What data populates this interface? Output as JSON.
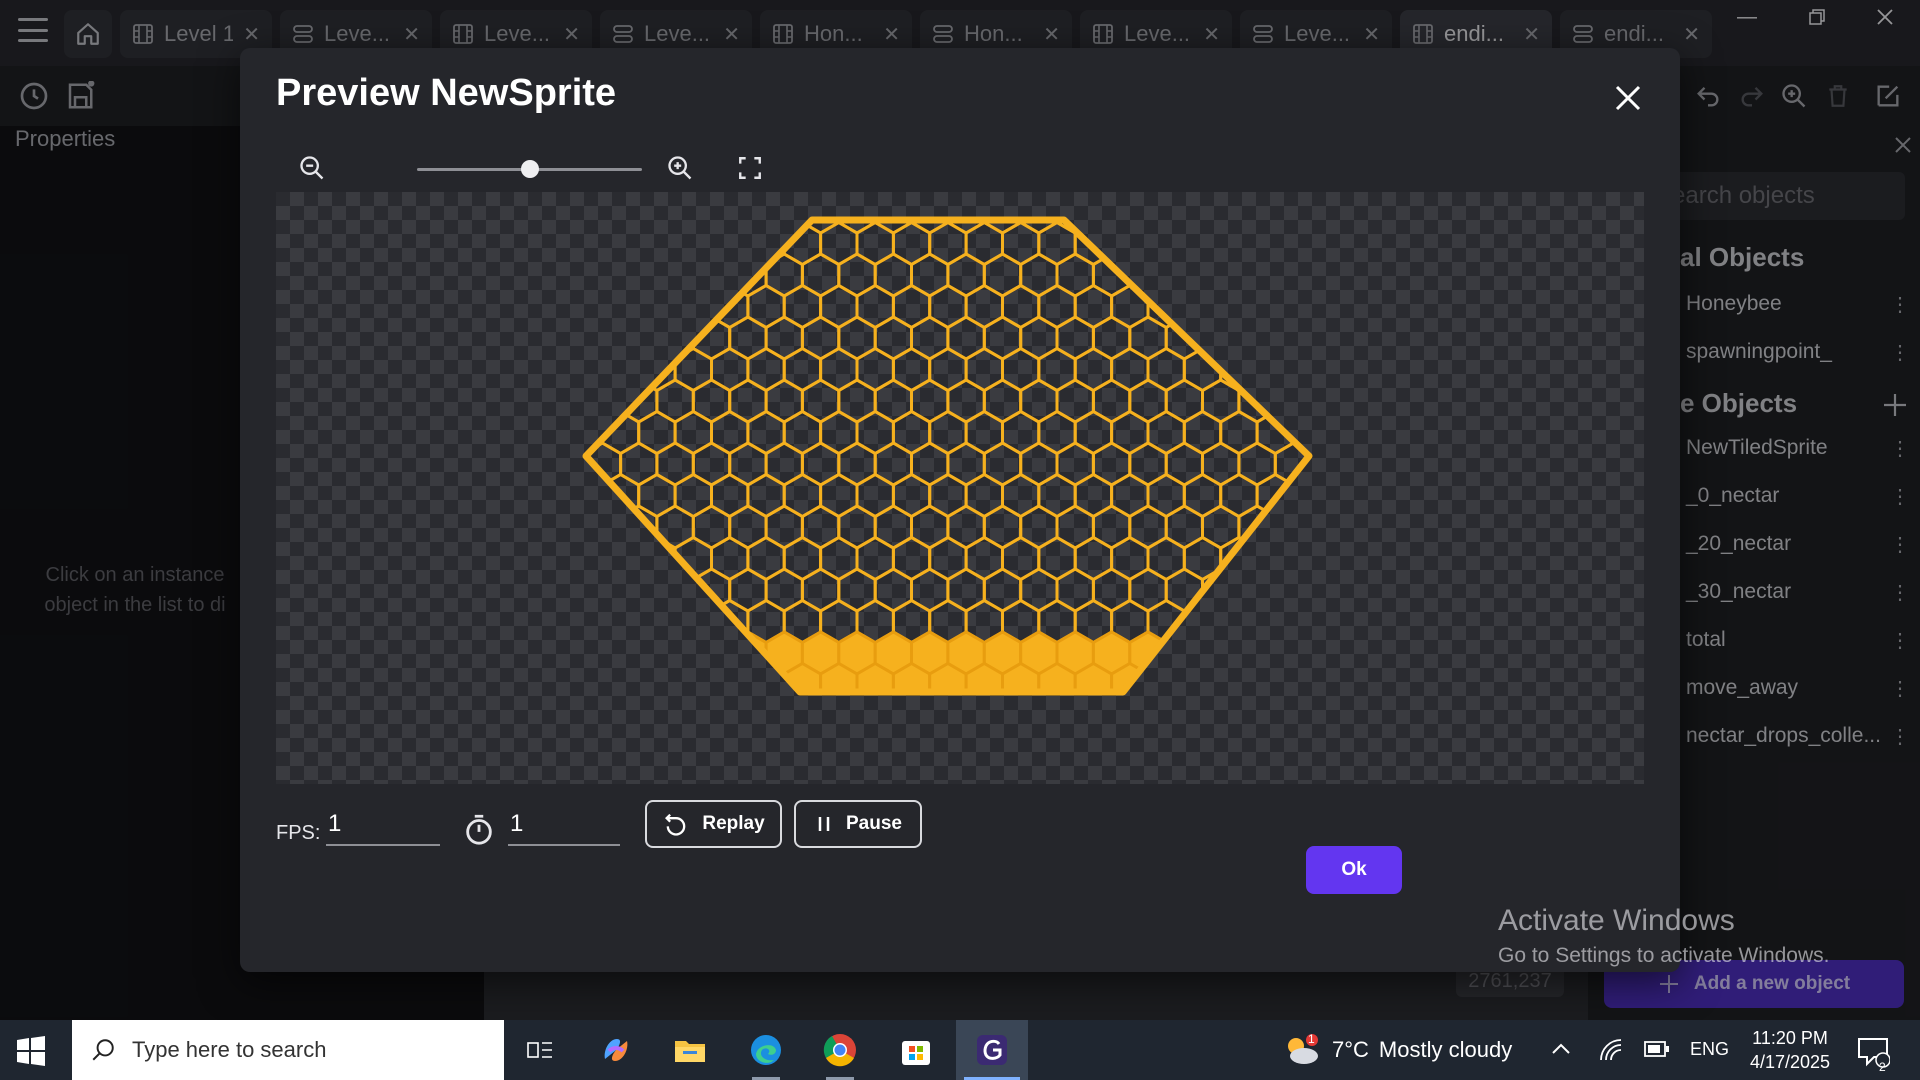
{
  "tabs": [
    {
      "label": "Level 1",
      "kind": "scene",
      "active": false
    },
    {
      "label": "Leve...",
      "kind": "events",
      "active": false
    },
    {
      "label": "Leve...",
      "kind": "scene",
      "active": false
    },
    {
      "label": "Leve...",
      "kind": "events",
      "active": false
    },
    {
      "label": "Hon...",
      "kind": "scene",
      "active": false
    },
    {
      "label": "Hon...",
      "kind": "events",
      "active": false
    },
    {
      "label": "Leve...",
      "kind": "scene",
      "active": false
    },
    {
      "label": "Leve...",
      "kind": "events",
      "active": false
    },
    {
      "label": "endi...",
      "kind": "scene",
      "active": true
    },
    {
      "label": "endi...",
      "kind": "events",
      "active": false
    }
  ],
  "properties": {
    "title": "Properties",
    "hint": "Click on an instance object in the list to di"
  },
  "objects_panel": {
    "search_placeholder": "earch objects",
    "global_header": "al Objects",
    "global_items": [
      "Honeybee",
      "spawningpoint_"
    ],
    "scene_header": "e Objects",
    "scene_items": [
      "NewTiledSprite",
      "_0_nectar",
      "_20_nectar",
      "_30_nectar",
      "total",
      "move_away",
      "nectar_drops_colle..."
    ],
    "add_button": "Add a new object",
    "coords": "2761,237"
  },
  "dialog": {
    "title": "Preview NewSprite",
    "zoom_level": 0.5,
    "fps_label": "FPS:",
    "fps_value": "1",
    "time_value": "1",
    "replay_label": "Replay",
    "pause_label": "Pause",
    "ok_label": "Ok",
    "accent": "#6336f0",
    "honey_color": "#f6b11e"
  },
  "watermark": {
    "line1": "Activate Windows",
    "line2": "Go to Settings to activate Windows."
  },
  "taskbar": {
    "search_placeholder": "Type here to search",
    "weather_temp": "7°C",
    "weather_text": "Mostly cloudy",
    "weather_badge": "1",
    "language": "ENG",
    "time": "11:20 PM",
    "date": "4/17/2025",
    "notifications": "2"
  }
}
